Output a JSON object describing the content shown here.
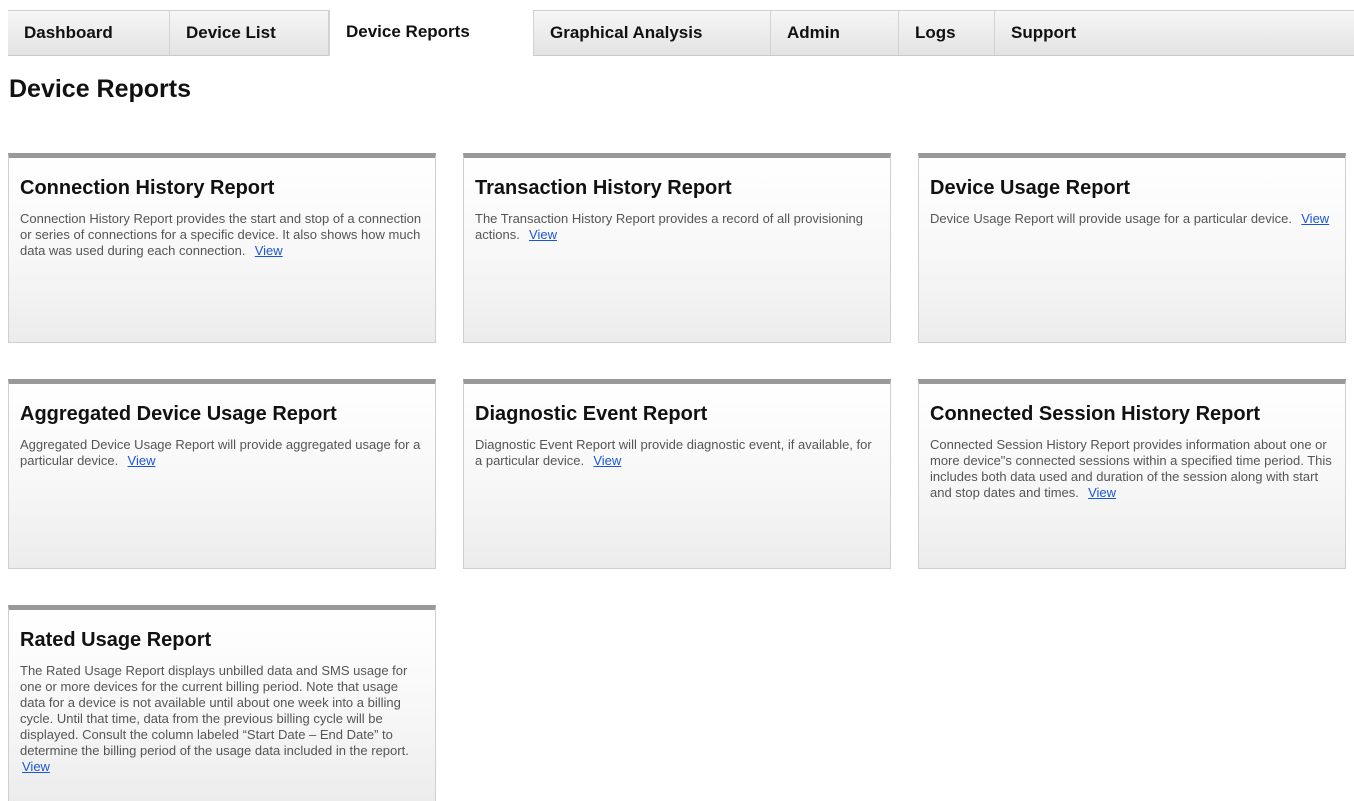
{
  "nav": {
    "tabs": [
      {
        "label": "Dashboard",
        "active": false
      },
      {
        "label": "Device List",
        "active": false
      },
      {
        "label": "Device Reports",
        "active": true
      },
      {
        "label": "Graphical Analysis",
        "active": false
      },
      {
        "label": "Admin",
        "active": false
      },
      {
        "label": "Logs",
        "active": false
      },
      {
        "label": "Support",
        "active": false
      }
    ]
  },
  "page": {
    "title": "Device Reports"
  },
  "reports": [
    {
      "title": "Connection History Report",
      "description": "Connection History Report provides the start and stop of a connection or series of connections for a specific device. It also shows how much data was used during each connection.",
      "link": "View"
    },
    {
      "title": "Transaction History Report",
      "description": "The Transaction History Report provides a record of all provisioning actions.",
      "link": "View"
    },
    {
      "title": "Device Usage Report",
      "description": "Device Usage Report will provide usage for a particular device.",
      "link": "View"
    },
    {
      "title": "Aggregated Device Usage Report",
      "description": "Aggregated Device Usage Report will provide aggregated usage for a particular device.",
      "link": "View"
    },
    {
      "title": "Diagnostic Event Report",
      "description": "Diagnostic Event Report will provide diagnostic event, if available, for a particular device.",
      "link": "View"
    },
    {
      "title": "Connected Session History Report",
      "description": "Connected Session History Report provides information about one or more device\"s connected sessions within a specified time period. This includes both data used and duration of the session along with start and stop dates and times.",
      "link": "View"
    },
    {
      "title": "Rated Usage Report",
      "description": "The Rated Usage Report displays unbilled data and SMS usage for one or more devices for the current billing period. Note that usage data for a device is not available until about one week into a billing cycle. Until that time, data from the previous billing cycle will be displayed. Consult the column labeled “Start Date – End Date” to determine the billing period of the usage data included in the report.",
      "link": "View"
    }
  ],
  "colors": {
    "link": "#1a57d6",
    "card_top_border": "#999999",
    "description_text": "#555555"
  }
}
